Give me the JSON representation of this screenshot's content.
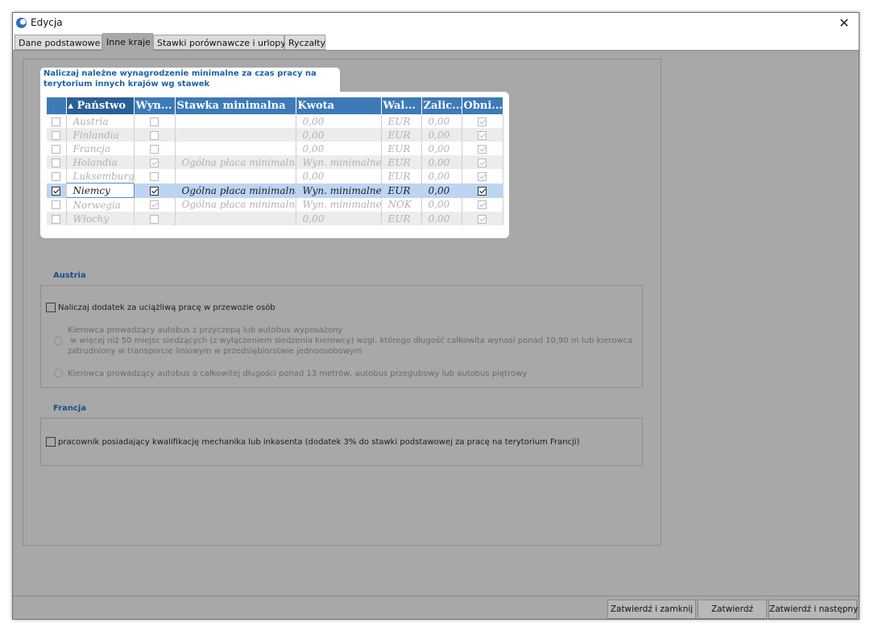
{
  "window": {
    "title": "Edycja",
    "close_glyph": "✕"
  },
  "tabs": [
    {
      "label": "Dane podstawowe",
      "active": false
    },
    {
      "label": "Inne kraje",
      "active": true
    },
    {
      "label": "Stawki porównawcze i urlopy",
      "active": false
    },
    {
      "label": "Ryczałty",
      "active": false
    }
  ],
  "callout": {
    "text": "Naliczaj należne wynagrodzenie minimalne za czas pracy na terytorium innych krajów wg stawek"
  },
  "grid": {
    "columns": [
      "",
      "▴ Państwo",
      "Wyn...",
      "Stawka minimalna",
      "Kwota",
      "Wal...",
      "Zalic...",
      "Obni..."
    ],
    "sorted_column": "Państwo",
    "rows": [
      {
        "selected_chk": false,
        "country": "Austria",
        "wyn": false,
        "stawka": "",
        "kwota": "0,00",
        "waluta": "EUR",
        "zalic": "0,00",
        "obni": true,
        "active": false
      },
      {
        "selected_chk": false,
        "country": "Finlandia",
        "wyn": false,
        "stawka": "",
        "kwota": "0,00",
        "waluta": "EUR",
        "zalic": "0,00",
        "obni": true,
        "active": false
      },
      {
        "selected_chk": false,
        "country": "Francja",
        "wyn": false,
        "stawka": "",
        "kwota": "0,00",
        "waluta": "EUR",
        "zalic": "0,00",
        "obni": true,
        "active": false
      },
      {
        "selected_chk": false,
        "country": "Holandia",
        "wyn": true,
        "stawka": "Ogólna płaca minimalna",
        "kwota": "Wyn. minimalne",
        "waluta": "EUR",
        "zalic": "0,00",
        "obni": true,
        "active": false
      },
      {
        "selected_chk": false,
        "country": "Luksemburg",
        "wyn": false,
        "stawka": "",
        "kwota": "0,00",
        "waluta": "EUR",
        "zalic": "0,00",
        "obni": true,
        "active": false
      },
      {
        "selected_chk": true,
        "country": "Niemcy",
        "wyn": true,
        "stawka": "Ogólna płaca minimalna",
        "kwota": "Wyn. minimalne",
        "waluta": "EUR",
        "zalic": "0,00",
        "obni": true,
        "active": true
      },
      {
        "selected_chk": false,
        "country": "Norwegia",
        "wyn": true,
        "stawka": "Ogólna płaca minimalna",
        "kwota": "Wyn. minimalne",
        "waluta": "NOK",
        "zalic": "0,00",
        "obni": true,
        "active": false
      },
      {
        "selected_chk": false,
        "country": "Włochy",
        "wyn": false,
        "stawka": "",
        "kwota": "0,00",
        "waluta": "EUR",
        "zalic": "0,00",
        "obni": true,
        "active": false
      }
    ]
  },
  "austria": {
    "title": "Austria",
    "checkbox_label": "Naliczaj dodatek za uciążliwą pracę w przewozie osób",
    "radio1_lines": [
      "Kierowca prowadzący autobus z przyczepą lub autobus wyposażony",
      " w więcej niż 50 miejsc siedzących (z wyłączeniem siedzenia kierowcy) wzgl. którego długość całkowita wynosi ponad 10,90 m lub kierowca",
      "zatrudniony w transporcie liniowym w przedsiębiorstwie jednoosobowym"
    ],
    "radio2": "Kierowca prowadzący autobus o całkowitej długości ponad 13 metrów, autobus przegubowy lub autobus piętrowy"
  },
  "francja": {
    "title": "Francja",
    "checkbox_label": "pracownik posiadający kwalifikację mechanika lub inkasenta (dodatek 3% do stawki podstawowej za pracę na terytorium Francji)"
  },
  "footer": {
    "btn_confirm_close": "Zatwierdź i zamknij",
    "btn_confirm": "Zatwierdź",
    "btn_confirm_next": "Zatwierdź i następny"
  }
}
